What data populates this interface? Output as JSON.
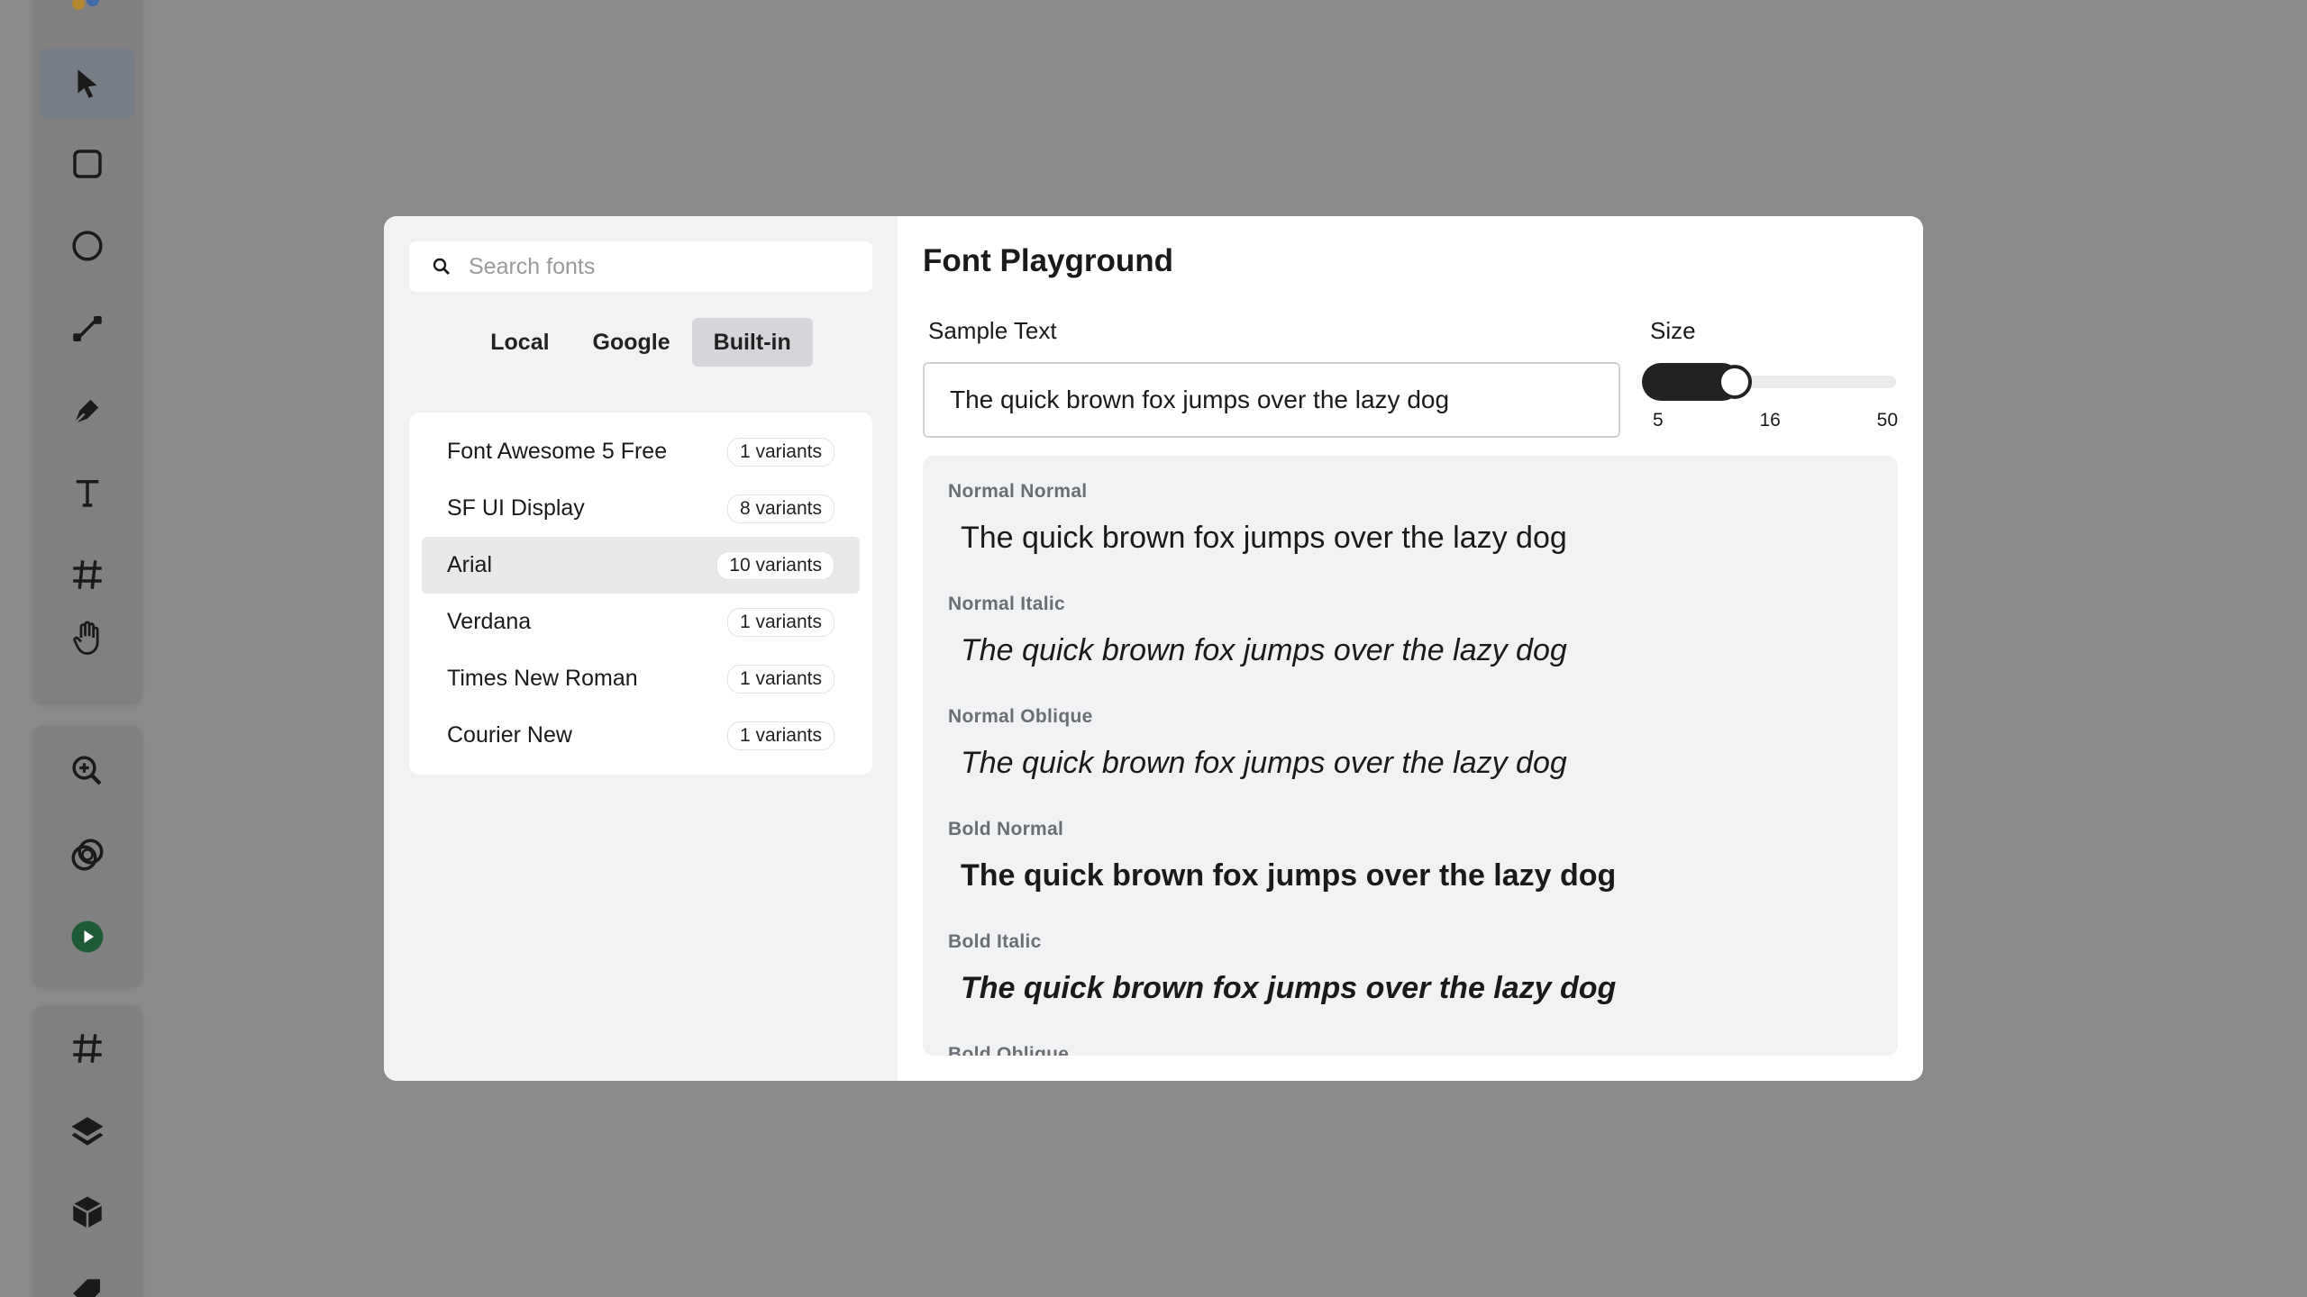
{
  "toolbar": {
    "groups": [
      {
        "items": [
          "pointer-icon",
          "rectangle-icon",
          "ellipse-icon",
          "line-icon",
          "pen-icon",
          "text-icon",
          "frame-icon",
          "hand-icon"
        ]
      },
      {
        "items": [
          "zoom-icon",
          "overlap-icon",
          "play-icon"
        ]
      },
      {
        "items": [
          "hash-icon",
          "layers-icon",
          "box-icon",
          "tag-icon"
        ]
      }
    ],
    "active": "pointer-icon",
    "play_color": "#1f5b36"
  },
  "fonts_panel": {
    "search_placeholder": "Search fonts",
    "tabs": [
      {
        "label": "Local",
        "selected": false
      },
      {
        "label": "Google",
        "selected": false
      },
      {
        "label": "Built-in",
        "selected": true
      }
    ],
    "fonts": [
      {
        "name": "Font Awesome 5 Free",
        "variants": "1 variants",
        "selected": false
      },
      {
        "name": "SF UI Display",
        "variants": "8 variants",
        "selected": false
      },
      {
        "name": "Arial",
        "variants": "10 variants",
        "selected": true
      },
      {
        "name": "Verdana",
        "variants": "1 variants",
        "selected": false
      },
      {
        "name": "Times New Roman",
        "variants": "1 variants",
        "selected": false
      },
      {
        "name": "Courier New",
        "variants": "1 variants",
        "selected": false
      }
    ]
  },
  "playground": {
    "title": "Font Playground",
    "sample_label": "Sample Text",
    "sample_text": "The quick brown fox jumps over the lazy dog",
    "size_label": "Size",
    "size": {
      "min": 5,
      "max": 50,
      "value": 16,
      "ticks": [
        "5",
        "16",
        "50"
      ]
    },
    "variants": [
      {
        "label": "Normal Normal",
        "weight": "normal",
        "style": "normal"
      },
      {
        "label": "Normal Italic",
        "weight": "normal",
        "style": "italic"
      },
      {
        "label": "Normal Oblique",
        "weight": "normal",
        "style": "oblique"
      },
      {
        "label": "Bold Normal",
        "weight": "bold",
        "style": "normal"
      },
      {
        "label": "Bold Italic",
        "weight": "bold",
        "style": "italic"
      },
      {
        "label": "Bold Oblique",
        "weight": "bold",
        "style": "oblique"
      }
    ]
  }
}
